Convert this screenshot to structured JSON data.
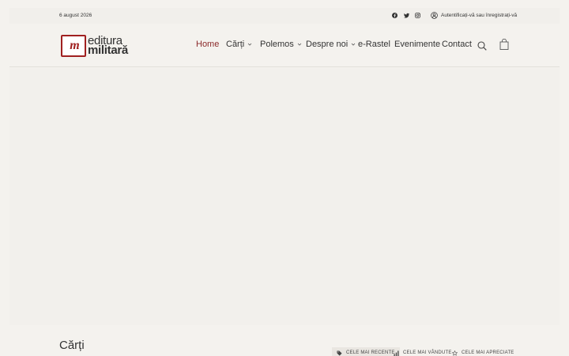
{
  "topbar": {
    "date": "6 august 2026",
    "social": [
      "facebook-icon",
      "twitter-icon",
      "instagram-icon"
    ],
    "login_label": "Autentificați-vă sau înregistrați-vă"
  },
  "logo": {
    "line1": "editura",
    "line2": "militară",
    "mark": "m"
  },
  "nav": {
    "items": [
      {
        "label": "Home",
        "has_dropdown": false,
        "active": true
      },
      {
        "label": "Cărți",
        "has_dropdown": true,
        "active": false
      },
      {
        "label": "Polemos",
        "has_dropdown": true,
        "active": false
      },
      {
        "label": "Despre noi",
        "has_dropdown": true,
        "active": false
      },
      {
        "label": "e-Rastel",
        "has_dropdown": false,
        "active": false
      },
      {
        "label": "Evenimente",
        "has_dropdown": false,
        "active": false
      },
      {
        "label": "Contact",
        "has_dropdown": false,
        "active": false
      }
    ],
    "icons": [
      "search-icon",
      "shopping-bag-icon"
    ]
  },
  "colors": {
    "accent": "#8b2a2a",
    "brand_red": "#a02020",
    "background": "#f4f2ee"
  },
  "section": {
    "title": "Cărți",
    "tabs": [
      {
        "label": "CELE MAI RECENTE",
        "icon": "tag-icon",
        "active": true
      },
      {
        "label": "CELE MAI VÂNDUTE",
        "icon": "bar-chart-icon",
        "active": false
      },
      {
        "label": "CELE MAI APRECIATE",
        "icon": "star-icon",
        "active": false
      }
    ]
  }
}
